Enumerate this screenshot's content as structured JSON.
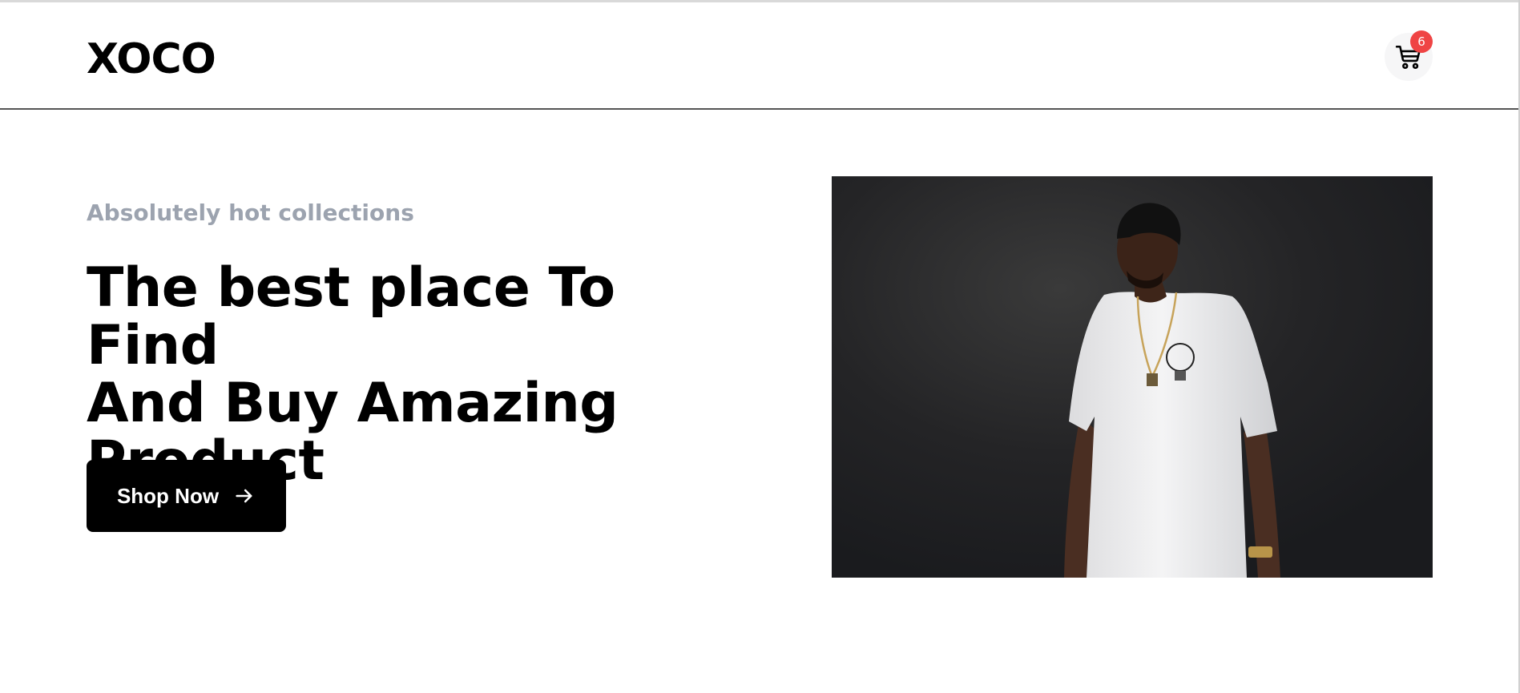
{
  "header": {
    "logo": "XOCO",
    "cart": {
      "count": "6",
      "icon": "shopping-cart-icon",
      "badge_color": "#ef4444"
    }
  },
  "hero": {
    "eyebrow": "Absolutely hot collections",
    "headline_line1": "The best place To Find",
    "headline_line2": "And Buy Amazing",
    "headline_line3": "Product",
    "cta": {
      "label": "Shop Now",
      "icon": "arrow-right-icon"
    },
    "image": {
      "subject": "model-in-white-tshirt-photo"
    }
  },
  "colors": {
    "accent": "#000000",
    "muted_text": "#9ca3af",
    "badge": "#ef4444",
    "photo_background": "#1e1e20"
  }
}
